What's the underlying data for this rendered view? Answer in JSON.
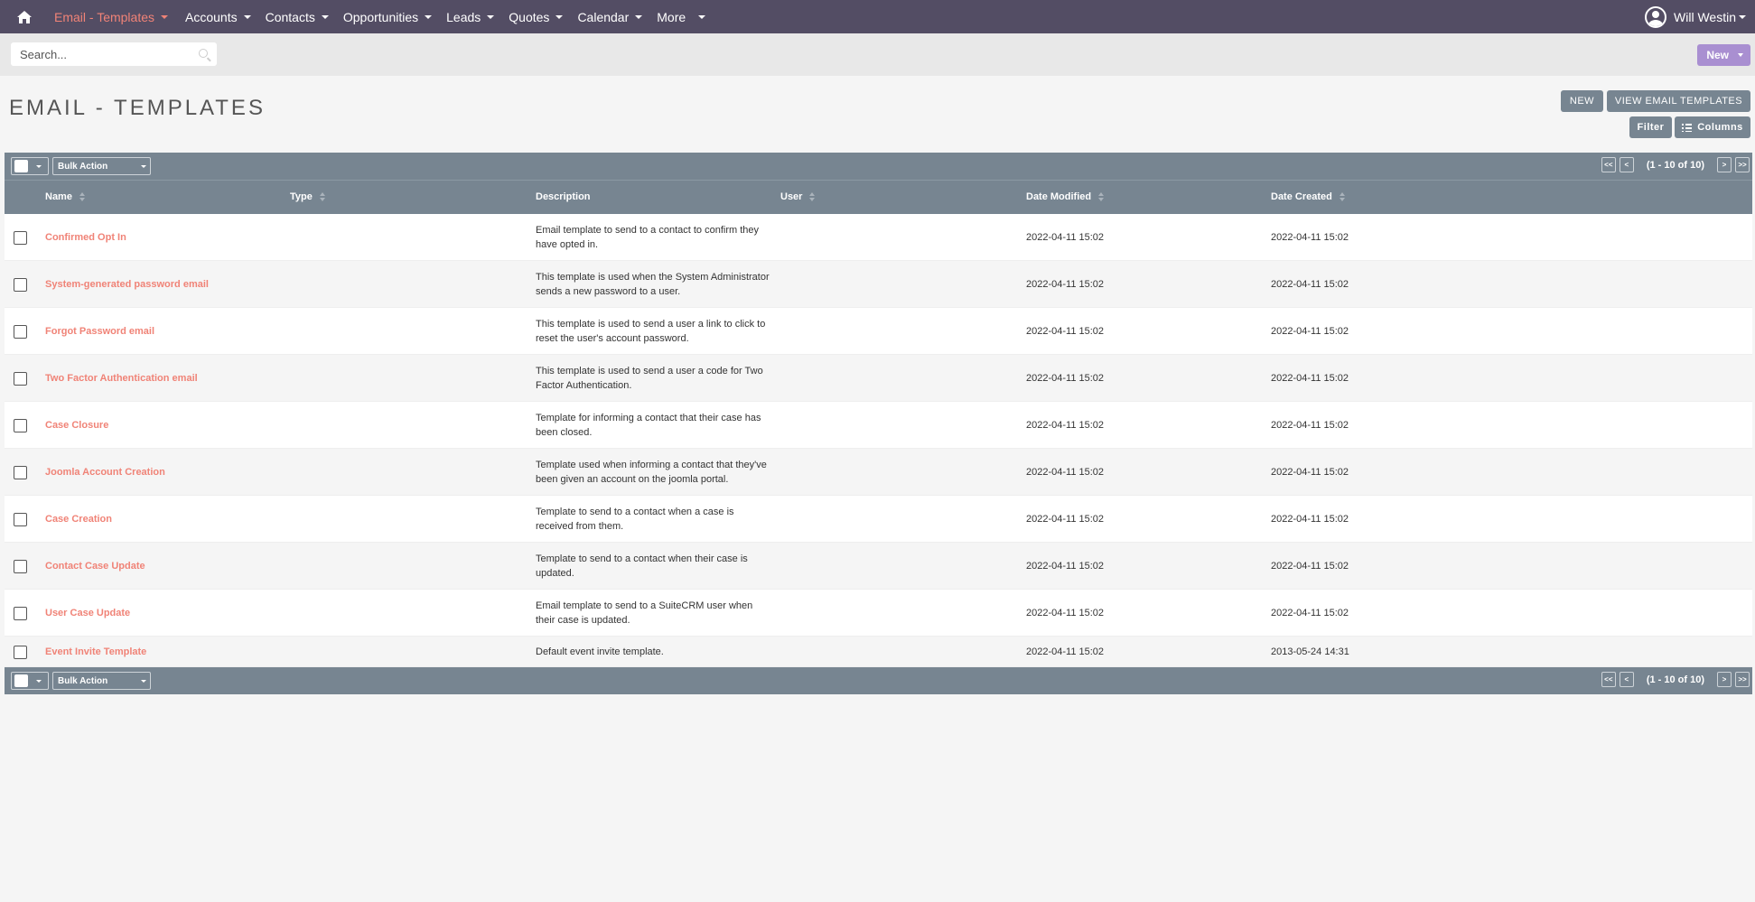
{
  "nav": {
    "active_module": "Email - Templates",
    "items": [
      "Accounts",
      "Contacts",
      "Opportunities",
      "Leads",
      "Quotes",
      "Calendar",
      "More"
    ],
    "user": "Will Westin"
  },
  "search": {
    "placeholder": "Search..."
  },
  "new_menu_label": "New",
  "header": {
    "title": "EMAIL - TEMPLATES",
    "new_button": "NEW",
    "view_button": "VIEW EMAIL TEMPLATES",
    "filter_button": "Filter",
    "columns_button": "Columns"
  },
  "list": {
    "bulk_action": "Bulk Action",
    "pagination": {
      "first": "<<",
      "prev": "<",
      "count": "(1 - 10 of 10)",
      "next": ">",
      "last": ">>"
    },
    "columns": [
      "Name",
      "Type",
      "Description",
      "User",
      "Date Modified",
      "Date Created"
    ],
    "rows": [
      {
        "name": "Confirmed Opt In",
        "type": "",
        "description": "Email template to send to a contact to confirm they have opted in.",
        "user": "",
        "modified": "2022-04-11 15:02",
        "created": "2022-04-11 15:02"
      },
      {
        "name": "System-generated password email",
        "type": "",
        "description": "This template is used when the System Administrator sends a new password to a user.",
        "user": "",
        "modified": "2022-04-11 15:02",
        "created": "2022-04-11 15:02"
      },
      {
        "name": "Forgot Password email",
        "type": "",
        "description": "This template is used to send a user a link to click to reset the user's account password.",
        "user": "",
        "modified": "2022-04-11 15:02",
        "created": "2022-04-11 15:02"
      },
      {
        "name": "Two Factor Authentication email",
        "type": "",
        "description": "This template is used to send a user a code for Two Factor Authentication.",
        "user": "",
        "modified": "2022-04-11 15:02",
        "created": "2022-04-11 15:02"
      },
      {
        "name": "Case Closure",
        "type": "",
        "description": "Template for informing a contact that their case has been closed.",
        "user": "",
        "modified": "2022-04-11 15:02",
        "created": "2022-04-11 15:02"
      },
      {
        "name": "Joomla Account Creation",
        "type": "",
        "description": "Template used when informing a contact that they've been given an account on the joomla portal.",
        "user": "",
        "modified": "2022-04-11 15:02",
        "created": "2022-04-11 15:02"
      },
      {
        "name": "Case Creation",
        "type": "",
        "description": "Template to send to a contact when a case is received from them.",
        "user": "",
        "modified": "2022-04-11 15:02",
        "created": "2022-04-11 15:02"
      },
      {
        "name": "Contact Case Update",
        "type": "",
        "description": "Template to send to a contact when their case is updated.",
        "user": "",
        "modified": "2022-04-11 15:02",
        "created": "2022-04-11 15:02"
      },
      {
        "name": "User Case Update",
        "type": "",
        "description": "Email template to send to a SuiteCRM user when their case is updated.",
        "user": "",
        "modified": "2022-04-11 15:02",
        "created": "2022-04-11 15:02"
      },
      {
        "name": "Event Invite Template",
        "type": "",
        "description": "Default event invite template.",
        "user": "",
        "modified": "2022-04-11 15:02",
        "created": "2013-05-24 14:31"
      }
    ]
  },
  "colors": {
    "nav_bg": "#534d64",
    "accent": "#f08377",
    "bar_bg": "#778591",
    "new_btn": "#a98fd1"
  }
}
